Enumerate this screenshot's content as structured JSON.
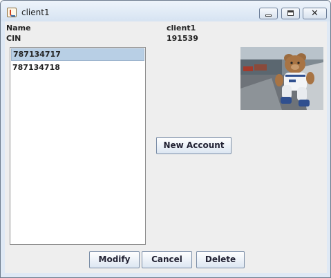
{
  "window": {
    "title": "client1"
  },
  "form": {
    "name_label": "Name",
    "name_value": "client1",
    "cin_label": "CIN",
    "cin_value": "191539"
  },
  "accounts": [
    "787134717",
    "787134718"
  ],
  "selected_account": "787134717",
  "buttons": {
    "new_account": "New Account",
    "modify": "Modify",
    "cancel": "Cancel",
    "delete": "Delete"
  },
  "icons": [
    "java-app-icon",
    "minimize-icon",
    "maximize-icon",
    "close-icon",
    "client-photo"
  ]
}
